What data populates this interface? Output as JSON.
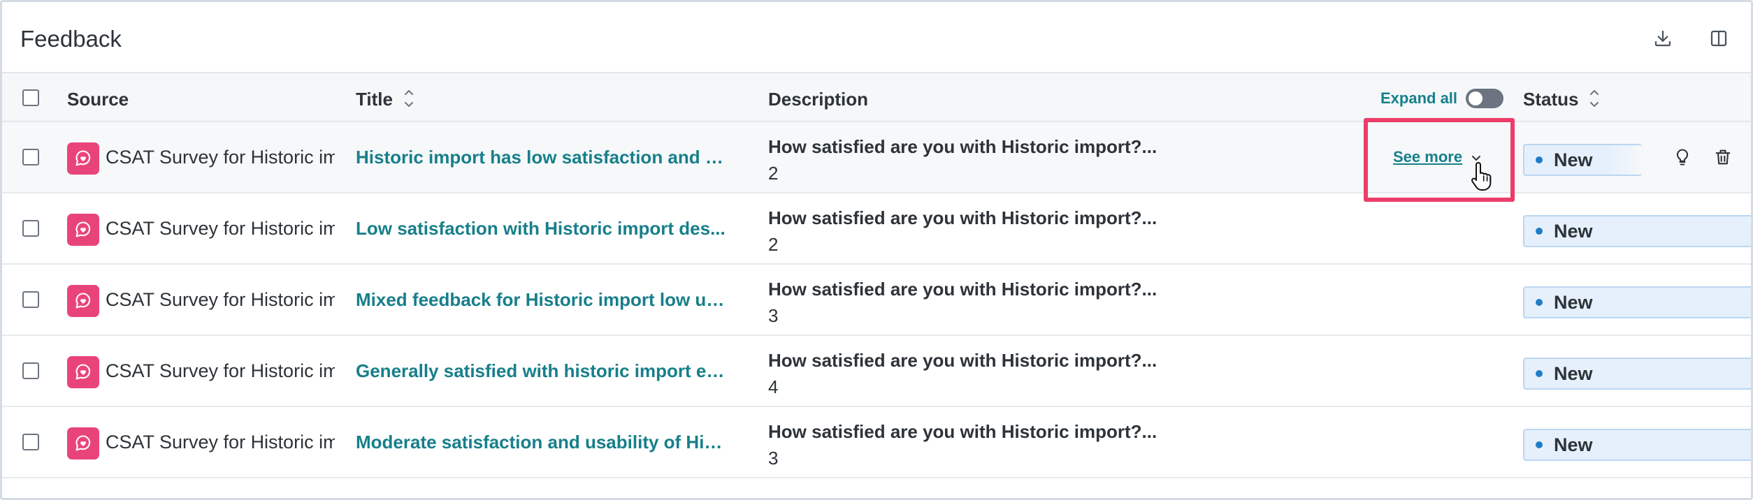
{
  "header": {
    "title": "Feedback",
    "download_icon": "download-icon",
    "panel_icon": "split-panel-icon"
  },
  "columns": {
    "source": "Source",
    "title": "Title",
    "description": "Description",
    "expand_all": "Expand all",
    "status": "Status"
  },
  "rows": [
    {
      "source": "CSAT Survey for Historic im",
      "title": "Historic import has low satisfaction and o...",
      "desc": "How satisfied are you with Historic import?...",
      "num": "2",
      "status": "New"
    },
    {
      "source": "CSAT Survey for Historic im",
      "title": "Low satisfaction with Historic import des...",
      "desc": "How satisfied are you with Historic import?...",
      "num": "2",
      "status": "New"
    },
    {
      "source": "CSAT Survey for Historic im",
      "title": "Mixed feedback for Historic import low us...",
      "desc": "How satisfied are you with Historic import?...",
      "num": "3",
      "status": "New"
    },
    {
      "source": "CSAT Survey for Historic im",
      "title": "Generally satisfied with historic import ex...",
      "desc": "How satisfied are you with Historic import?...",
      "num": "4",
      "status": "New"
    },
    {
      "source": "CSAT Survey for Historic im",
      "title": "Moderate satisfaction and usability of His...",
      "desc": "How satisfied are you with Historic import?...",
      "num": "3",
      "status": "New"
    }
  ],
  "see_more": "See more",
  "colors": {
    "accent_teal": "#177f8a",
    "source_icon": "#e9447a",
    "highlight": "#ec3d6a",
    "status_bg": "#e5f0fc"
  }
}
